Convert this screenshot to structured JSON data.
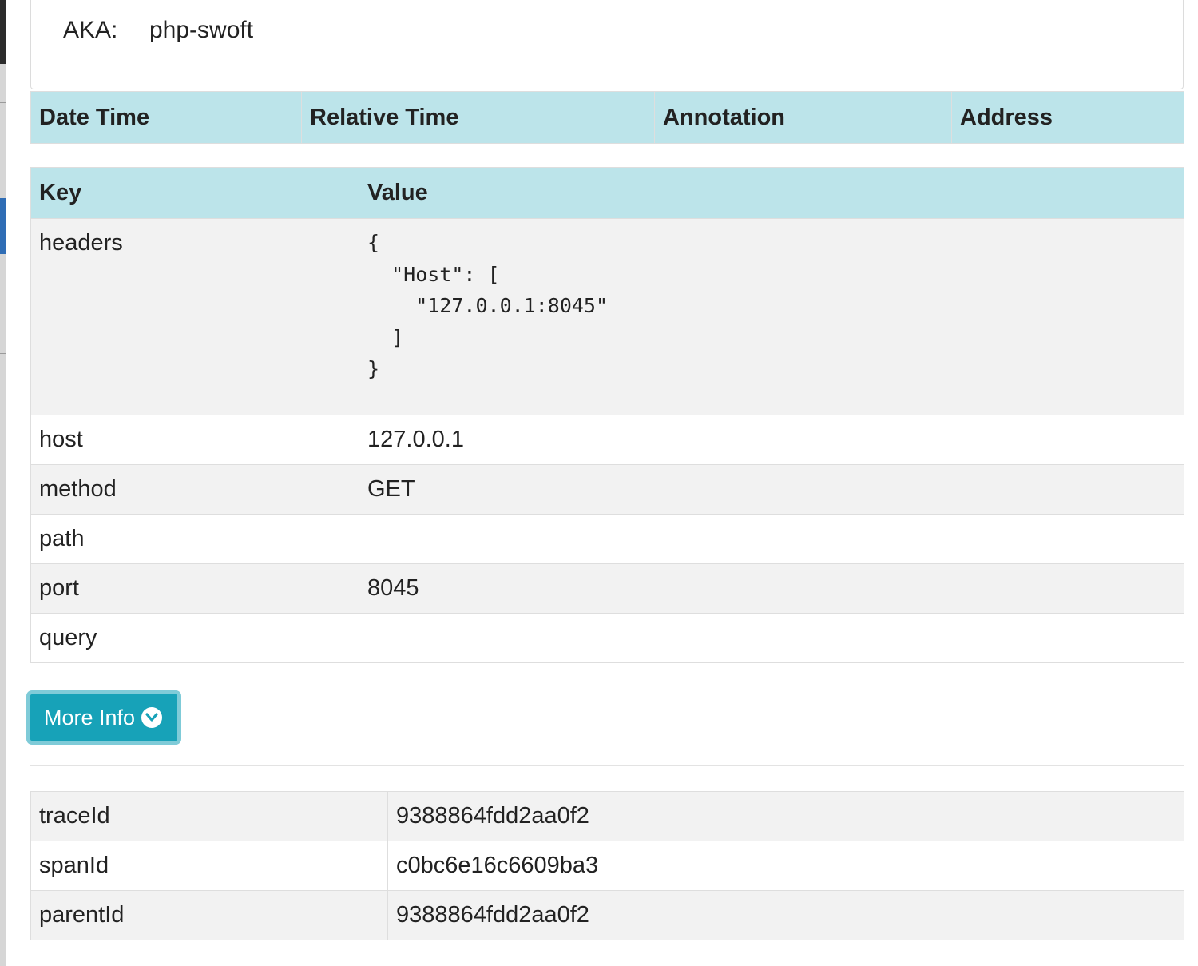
{
  "aka": {
    "label": "AKA:",
    "value": "php-swoft"
  },
  "annotations_table": {
    "headers": [
      "Date Time",
      "Relative Time",
      "Annotation",
      "Address"
    ]
  },
  "tags_table": {
    "headers": [
      "Key",
      "Value"
    ],
    "rows": [
      {
        "key": "headers",
        "value": "{\n  \"Host\": [\n    \"127.0.0.1:8045\"\n  ]\n}"
      },
      {
        "key": "host",
        "value": "127.0.0.1"
      },
      {
        "key": "method",
        "value": "GET"
      },
      {
        "key": "path",
        "value": ""
      },
      {
        "key": "port",
        "value": "8045"
      },
      {
        "key": "query",
        "value": ""
      }
    ]
  },
  "more_info": {
    "label": "More Info",
    "icon": "chevron-circle-down-icon"
  },
  "ids_table": {
    "rows": [
      {
        "key": "traceId",
        "value": "9388864fdd2aa0f2"
      },
      {
        "key": "spanId",
        "value": "c0bc6e16c6609ba3"
      },
      {
        "key": "parentId",
        "value": "9388864fdd2aa0f2"
      }
    ]
  },
  "colors": {
    "header_bg": "#bce4ea",
    "button_bg": "#17a2b8",
    "button_ring": "#7fcbd8",
    "stripe_bg": "#f2f2f2"
  }
}
